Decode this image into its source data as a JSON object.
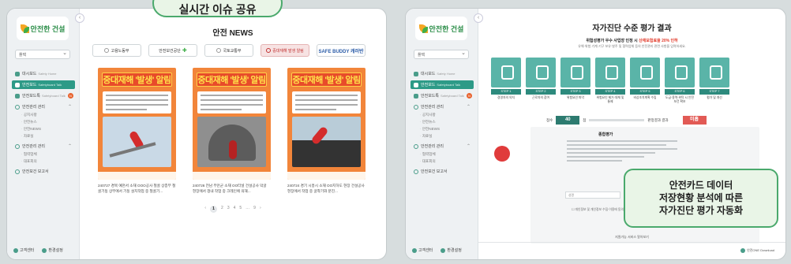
{
  "logo": {
    "text": "안전한 건설"
  },
  "select": {
    "value": "플택"
  },
  "left": {
    "title": "안전 NEWS",
    "tabs": [
      {
        "label": "고용노동부"
      },
      {
        "label": "안전보건공단"
      },
      {
        "label": "국토교통부"
      },
      {
        "label": "중대재해 발생 알림"
      },
      {
        "label": "SAFE BUDDY 캐러반"
      }
    ],
    "cards": [
      {
        "banner": "중대재해 '발생' 알림",
        "caption": "240727 경북 예천서 소재 OOO공사 철골 상층부 철골기둥 상부에서 기둥 설치작업 중 철골기..."
      },
      {
        "banner": "중대재해 '발생' 알림",
        "caption": "240726 전남 무안군 소재 OO터널 건설공사 막굴 현장에서 갱내 작업 중 크레인에 의해..."
      },
      {
        "banner": "중대재해 '발생' 알림",
        "caption": "240724 경기 시흥시 소재 OO지하도 현장 건설공사 현장에서 작업 중 굴착기와 분진..."
      }
    ],
    "pager": {
      "prev": "‹",
      "current": "1",
      "pages": [
        "2",
        "3",
        "4",
        "5",
        "…",
        "9"
      ],
      "next": "›"
    }
  },
  "menu": {
    "items": [
      {
        "label": "대시보드",
        "en": "Safety Home",
        "active": false
      },
      {
        "label": "안전보드",
        "en": "Safetyboard Talk",
        "active": true
      },
      {
        "label": "안전보드톡",
        "en": "Safetyboard Talk",
        "active": false,
        "badge": "N"
      }
    ],
    "group1": {
      "label": "안전관리 관리",
      "subs": [
        "공지사항",
        "안전뉴스",
        "안전NEWS",
        "자료실"
      ]
    },
    "group2": {
      "label": "안전관리 관리",
      "subs": [
        "협력업체",
        "대표회의"
      ]
    },
    "group3": {
      "label": "안전보건 보고서"
    }
  },
  "footer": {
    "customer": "고객센터",
    "settings": "환경설정"
  },
  "right": {
    "title": "자가진단 수준 평가 결과",
    "subtitle_prefix": "위험성평가 우수 사업장 인정 시",
    "subtitle_highlight": "산재보험료율 20% 인하",
    "desc": "유해·위험 기계·기구 보유·발주 및 협력업체 등의 안전관리 관련 사항을 입력하세요.",
    "steps": [
      {
        "label": "STEP 1",
        "desc": "경영자의 의지"
      },
      {
        "label": "STEP 2",
        "desc": "근로자의 참여"
      },
      {
        "label": "STEP 3",
        "desc": "위험요인 파악"
      },
      {
        "label": "STEP 4",
        "desc": "위험요인 제거·대체 및 통제"
      },
      {
        "label": "STEP 5",
        "desc": "비상조치계획 수립"
      },
      {
        "label": "STEP 6",
        "desc": "도급·용역·위탁 시 안전보건 확보"
      },
      {
        "label": "STEP 7",
        "desc": "평가 및 개선"
      }
    ],
    "score_label": "점수",
    "score": "40",
    "score_unit": "점",
    "grade_label": "판정결과 결과",
    "grade": "미흡",
    "result_title": "종합평가",
    "input1": "성명",
    "input2": "연락처",
    "check": "개인정보 및 개인정보 수집·이용에 동의합니다.",
    "btn1": "상담신청",
    "btn2": "안전진단 인증 상담 신청",
    "footer_title": "지원가능 서비스 알아보기",
    "download": "안전ONE Download"
  },
  "callouts": {
    "top": "실시간 이슈 공유",
    "bottom": [
      "안전카드 데이터",
      "저장현황 분석에 따른",
      "자가진단 평가 자동화"
    ]
  }
}
